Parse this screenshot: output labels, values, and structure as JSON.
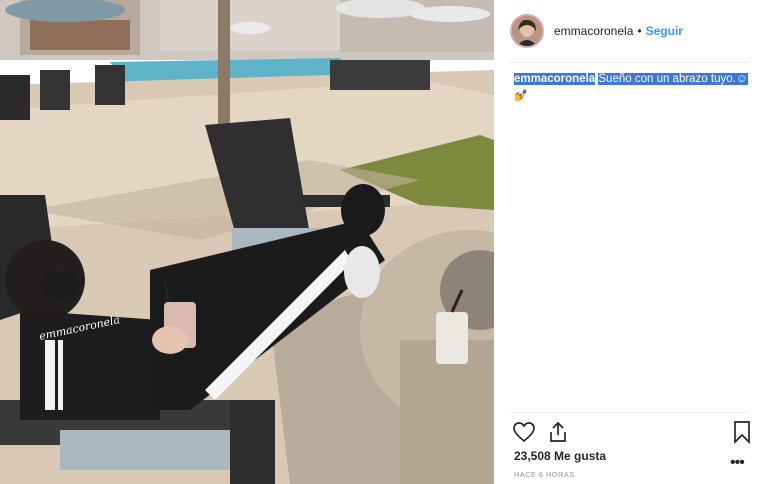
{
  "post": {
    "header": {
      "username": "emmacoronela",
      "separator": "•",
      "follow_label": "Seguir"
    },
    "caption": {
      "username": "emmacoronela",
      "text": "Sueño con un abrazo tuyo.☺",
      "extra_emoji": "💅"
    },
    "photo": {
      "shirt_text": "emmacoronela"
    },
    "actions": {
      "like_icon": "heart-icon",
      "share_icon": "share-icon",
      "save_icon": "bookmark-icon",
      "more_icon": "ellipsis-icon"
    },
    "likes": "23,508 Me gusta",
    "timestamp": "HACE 6 HORAS",
    "colors": {
      "accent": "#3897f0",
      "selection": "#3b78d8",
      "text": "#262626",
      "muted": "#999999"
    }
  }
}
